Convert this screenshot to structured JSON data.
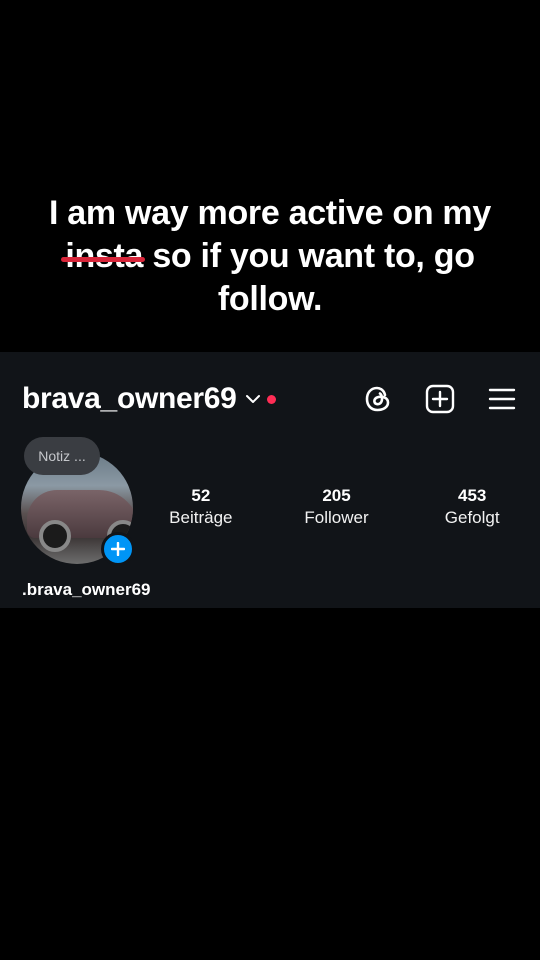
{
  "caption": {
    "line1": "I am way more active on my",
    "struck_word": "insta",
    "line2_rest": " so if you want to, go",
    "line3": "follow."
  },
  "profile": {
    "username": "brava_owner69",
    "note_label": "Notiz ...",
    "display_name": ".brava_owner69",
    "stats": [
      {
        "value": "52",
        "label": "Beiträge"
      },
      {
        "value": "205",
        "label": "Follower"
      },
      {
        "value": "453",
        "label": "Gefolgt"
      }
    ]
  },
  "icons": {
    "threads": "threads-icon",
    "add_post": "add-post-icon",
    "menu": "menu-icon",
    "dropdown": "chevron-down-icon",
    "add_story": "plus-icon"
  },
  "colors": {
    "accent": "#0095f6",
    "notification_dot": "#ff2d55",
    "strike": "#d8263a",
    "panel_bg": "#111418"
  }
}
